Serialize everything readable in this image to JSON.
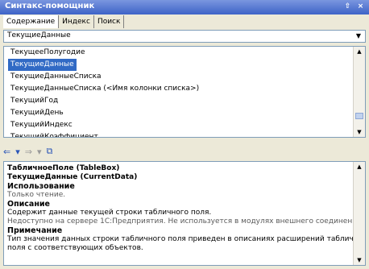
{
  "window": {
    "title": "Синтакс-помощник",
    "pin": "⇧",
    "close": "×"
  },
  "tabs": [
    {
      "label": "Содержание"
    },
    {
      "label": "Индекс"
    },
    {
      "label": "Поиск"
    }
  ],
  "combo": {
    "value": "ТекущиеДанные"
  },
  "list": {
    "items": [
      {
        "label": "ТекущееПолугодие"
      },
      {
        "label": "ТекущиеДанные"
      },
      {
        "label": "ТекущиеДанныеСписка"
      },
      {
        "label": "ТекущиеДанныеСписка (<Имя колонки списка>)"
      },
      {
        "label": "ТекущийГод"
      },
      {
        "label": "ТекущийДень"
      },
      {
        "label": "ТекущийИндекс"
      },
      {
        "label": "ТекущийКоэффициент"
      }
    ],
    "selected_index": 1
  },
  "toolbar": {
    "back_icon": "⇐",
    "forward_icon": "⇒",
    "dd": "▾",
    "sync_icon": "⧉"
  },
  "content": {
    "line1": "ТабличноеПоле (TableBox)",
    "line2": "ТекущиеДанные (CurrentData)",
    "sec_usage": "Использование",
    "usage_text": "Только чтение.",
    "sec_desc": "Описание",
    "desc_text": "Содержит данные текущей строки табличного поля.",
    "avail_text": "Недоступно на сервере 1С:Предприятия. Не используется в модулях внешнего соединения.",
    "sec_note": "Примечание",
    "note_text1": "Тип значения данных строки табличного поля приведен в описаниях расширений табличного",
    "note_text2": "поля с соответствующих объектов."
  }
}
